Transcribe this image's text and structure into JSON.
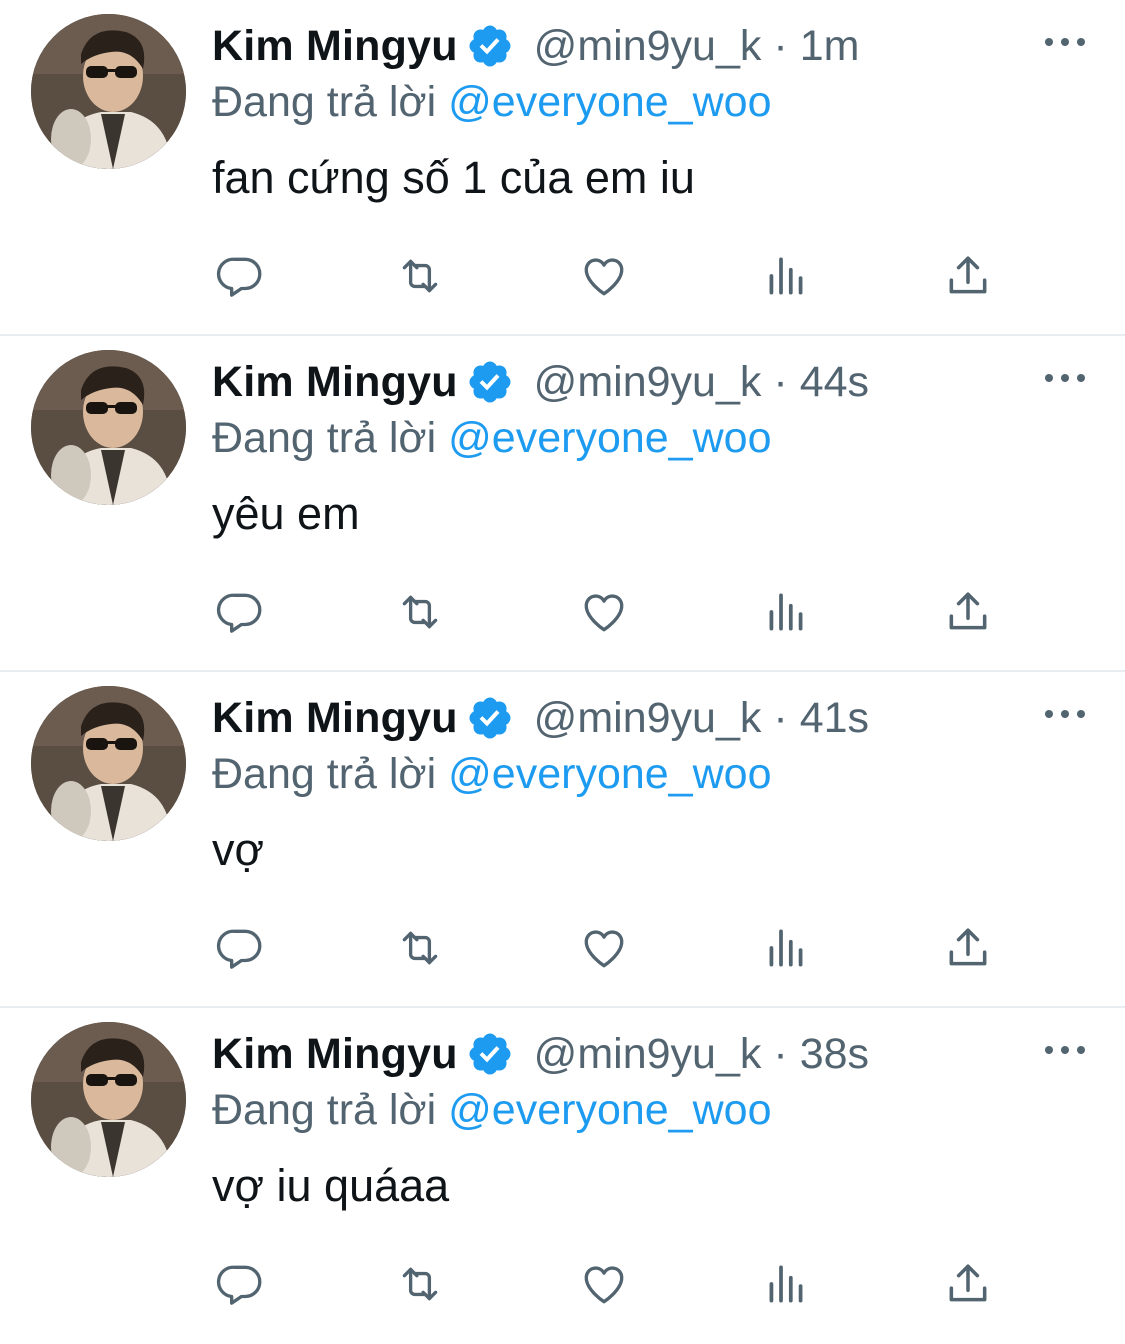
{
  "colors": {
    "text": "#0f1419",
    "secondary": "#536471",
    "accent": "#1d9bf0",
    "divider": "#e6ecf0"
  },
  "tweets": [
    {
      "author_name": "Kim Mingyu",
      "handle": "@min9yu_k",
      "separator": "·",
      "time": "1m",
      "reply_prefix": "Đang trả lời",
      "reply_to": "@everyone_woo",
      "text": "fan cứng số 1 của em iu"
    },
    {
      "author_name": "Kim Mingyu",
      "handle": "@min9yu_k",
      "separator": "·",
      "time": "44s",
      "reply_prefix": "Đang trả lời",
      "reply_to": "@everyone_woo",
      "text": "yêu em"
    },
    {
      "author_name": "Kim Mingyu",
      "handle": "@min9yu_k",
      "separator": "·",
      "time": "41s",
      "reply_prefix": "Đang trả lời",
      "reply_to": "@everyone_woo",
      "text": "vợ"
    },
    {
      "author_name": "Kim Mingyu",
      "handle": "@min9yu_k",
      "separator": "·",
      "time": "38s",
      "reply_prefix": "Đang trả lời",
      "reply_to": "@everyone_woo",
      "text": "vợ iu quáaa"
    }
  ],
  "icons": {
    "verified": "verified-badge-icon",
    "more": "more-dots-icon",
    "reply": "comment-bubble-icon",
    "retweet": "retweet-icon",
    "like": "heart-icon",
    "stats": "bar-chart-icon",
    "share": "share-upload-icon"
  }
}
